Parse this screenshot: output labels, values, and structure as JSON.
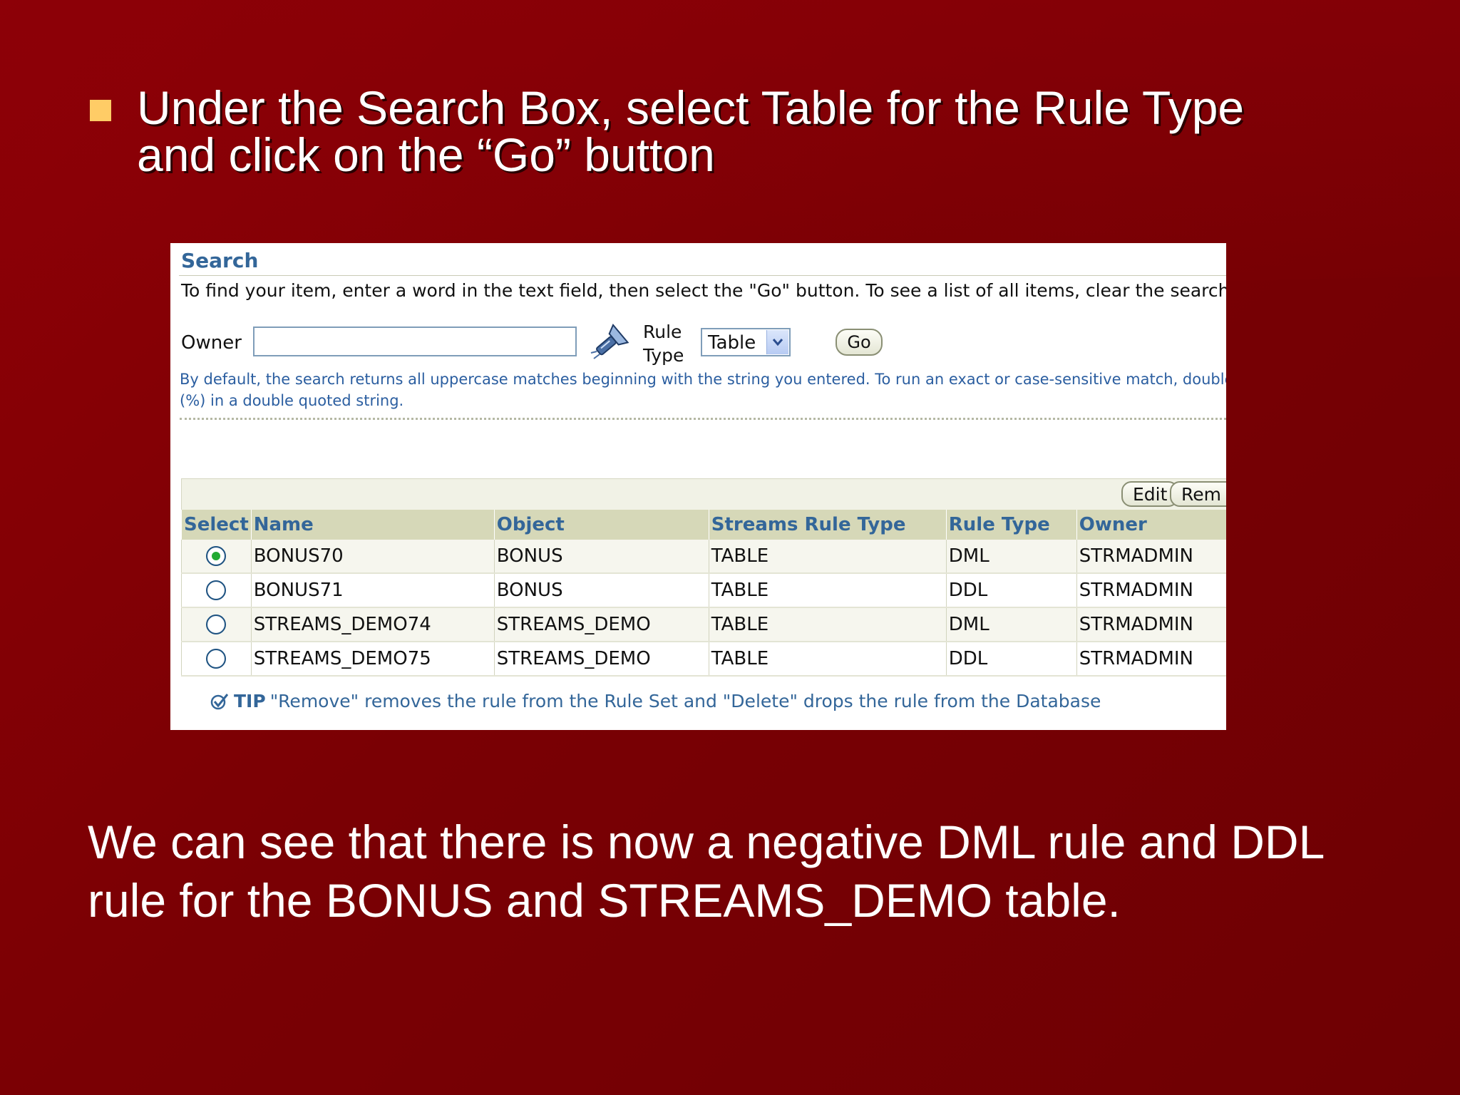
{
  "slide": {
    "bullet_lines": [
      "Under the Search Box, select Table for the Rule Type",
      "and click on the “Go” button"
    ],
    "summary_lines": [
      "We can see that there is now a negative DML rule and DDL",
      "rule for the BONUS and STREAMS_DEMO table."
    ]
  },
  "screenshot": {
    "search_title": "Search",
    "instructions": "To find your item, enter a word in the text field, then select the \"Go\" button. To see a list of all items, clear the search b",
    "owner_label": "Owner",
    "owner_value": "",
    "rule_type_label_line1": "Rule",
    "rule_type_label_line2": "Type",
    "rule_type_selected": "Table",
    "go_label": "Go",
    "hint_line1": "By default, the search returns all uppercase matches beginning with the string you entered. To run an exact or case-sensitive match, double q",
    "hint_line2": "(%) in a double quoted string.",
    "edit_label": "Edit",
    "remove_label": "Rem",
    "columns": [
      "Select",
      "Name",
      "Object",
      "Streams Rule Type",
      "Rule Type",
      "Owner"
    ],
    "rows": [
      {
        "selected": true,
        "name": "BONUS70",
        "object": "BONUS",
        "streams_rule_type": "TABLE",
        "rule_type": "DML",
        "owner": "STRMADMIN"
      },
      {
        "selected": false,
        "name": "BONUS71",
        "object": "BONUS",
        "streams_rule_type": "TABLE",
        "rule_type": "DDL",
        "owner": "STRMADMIN"
      },
      {
        "selected": false,
        "name": "STREAMS_DEMO74",
        "object": "STREAMS_DEMO",
        "streams_rule_type": "TABLE",
        "rule_type": "DML",
        "owner": "STRMADMIN"
      },
      {
        "selected": false,
        "name": "STREAMS_DEMO75",
        "object": "STREAMS_DEMO",
        "streams_rule_type": "TABLE",
        "rule_type": "DDL",
        "owner": "STRMADMIN"
      }
    ],
    "tip_label": "TIP",
    "tip_text": "\"Remove\" removes the rule from the Rule Set and \"Delete\" drops the rule from the Database"
  },
  "colors": {
    "background": "#7a0004",
    "bullet": "#ffcc66",
    "oracle_blue": "#336699",
    "header_bg": "#d6d8b8"
  },
  "icons": {
    "bullet": "square-bullet-icon",
    "flashlight": "flashlight-icon",
    "select_arrow": "chevron-down-icon",
    "tip": "checkmark-icon"
  }
}
